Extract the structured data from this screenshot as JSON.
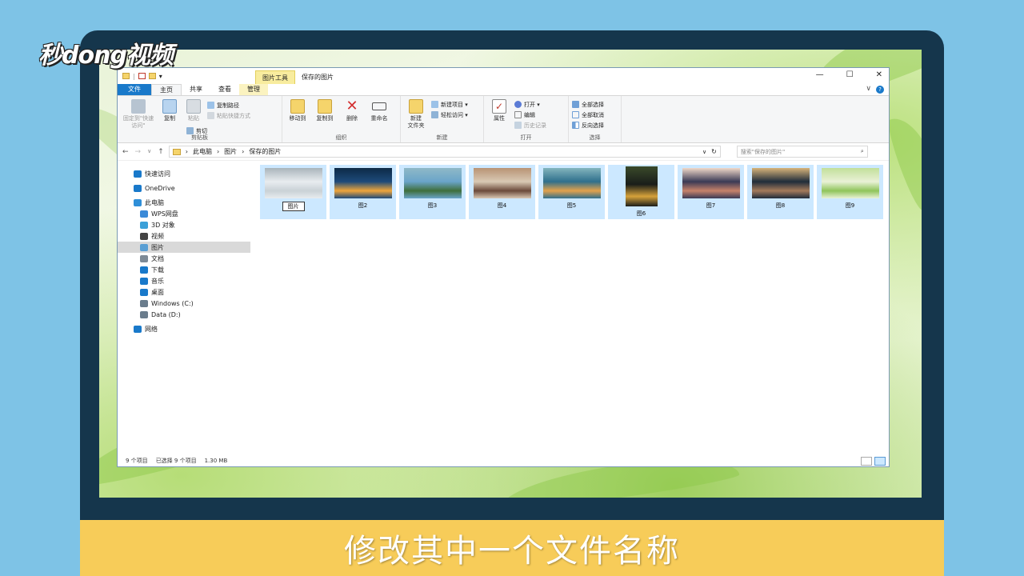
{
  "brand": {
    "logo_text": "秒dong视频"
  },
  "caption": "修改其中一个文件名称",
  "window": {
    "title": "保存的图片",
    "context_tab_group": "图片工具",
    "controls": {
      "minimize": "—",
      "maximize": "☐",
      "close": "✕"
    },
    "tabs": [
      "文件",
      "主页",
      "共享",
      "查看",
      "管理"
    ],
    "ribbon": {
      "clipboard": {
        "label": "剪贴板",
        "pin": "固定到\"快速访问\"",
        "copy": "复制",
        "paste": "粘贴",
        "copy_path": "复制路径",
        "paste_shortcut": "粘贴快捷方式",
        "cut": "剪切"
      },
      "organize": {
        "label": "组织",
        "move_to": "移动到",
        "copy_to": "复制到",
        "delete": "删除",
        "rename": "重命名"
      },
      "new": {
        "label": "新建",
        "new_folder": "新建\n文件夹",
        "new_item": "新建项目 ▾",
        "easy_access": "轻松访问 ▾"
      },
      "open": {
        "label": "打开",
        "properties": "属性",
        "open": "打开 ▾",
        "edit": "编辑",
        "history": "历史记录"
      },
      "select": {
        "label": "选择",
        "select_all": "全部选择",
        "select_none": "全部取消",
        "invert": "反向选择"
      }
    },
    "address": {
      "path": [
        "此电脑",
        "图片",
        "保存的图片"
      ],
      "search_placeholder": "搜索\"保存的图片\""
    },
    "nav_pane": [
      {
        "label": "快速访问",
        "level": 0,
        "icon": "star-icon",
        "color": "#1979ca"
      },
      {
        "label": "OneDrive",
        "level": 0,
        "icon": "cloud-icon",
        "color": "#1979ca"
      },
      {
        "label": "此电脑",
        "level": 0,
        "icon": "computer-icon",
        "color": "#2f8fd8"
      },
      {
        "label": "WPS网盘",
        "level": 1,
        "icon": "cloud-outline-icon",
        "color": "#3b8ad8"
      },
      {
        "label": "3D 对象",
        "level": 1,
        "icon": "cube-icon",
        "color": "#3ba0d8"
      },
      {
        "label": "视频",
        "level": 1,
        "icon": "film-icon",
        "color": "#444"
      },
      {
        "label": "图片",
        "level": 1,
        "icon": "picture-icon",
        "color": "#5a9fd4",
        "selected": true
      },
      {
        "label": "文档",
        "level": 1,
        "icon": "document-icon",
        "color": "#7d8a96"
      },
      {
        "label": "下载",
        "level": 1,
        "icon": "download-icon",
        "color": "#1979ca"
      },
      {
        "label": "音乐",
        "level": 1,
        "icon": "music-icon",
        "color": "#1979ca"
      },
      {
        "label": "桌面",
        "level": 1,
        "icon": "desktop-icon",
        "color": "#1979ca"
      },
      {
        "label": "Windows (C:)",
        "level": 1,
        "icon": "drive-c-icon",
        "color": "#6a7c8c"
      },
      {
        "label": "Data (D:)",
        "level": 1,
        "icon": "drive-d-icon",
        "color": "#6a7c8c"
      },
      {
        "label": "网络",
        "level": 0,
        "icon": "network-icon",
        "color": "#1979ca"
      }
    ],
    "files": [
      {
        "name": "图片",
        "editing": true,
        "colors": [
          "#e8ecef",
          "#c9d1d6",
          "#a9b4bb"
        ]
      },
      {
        "name": "图2",
        "colors": [
          "#1d4a7a",
          "#f0a63a",
          "#0d2a47"
        ]
      },
      {
        "name": "图3",
        "colors": [
          "#6aa4c9",
          "#3e6e3a",
          "#8fb9c7"
        ]
      },
      {
        "name": "图4",
        "colors": [
          "#d9c9b4",
          "#6b4a3a",
          "#b89374"
        ]
      },
      {
        "name": "图5",
        "colors": [
          "#2f6f8c",
          "#e3a24b",
          "#83b5bd"
        ]
      },
      {
        "name": "图6",
        "colors": [
          "#1a1d1a",
          "#d6a23a",
          "#3a4a2a"
        ],
        "tall": true
      },
      {
        "name": "图7",
        "colors": [
          "#3a3a55",
          "#c7836a",
          "#f0d9c9"
        ]
      },
      {
        "name": "图8",
        "colors": [
          "#1f2c3a",
          "#a47b5b",
          "#d7b37a"
        ]
      },
      {
        "name": "图9",
        "colors": [
          "#e9f1d6",
          "#8fc45a",
          "#c2df9a"
        ]
      }
    ],
    "status": {
      "count": "9 个项目",
      "selected": "已选择 9 个项目",
      "size": "1.30 MB"
    }
  }
}
